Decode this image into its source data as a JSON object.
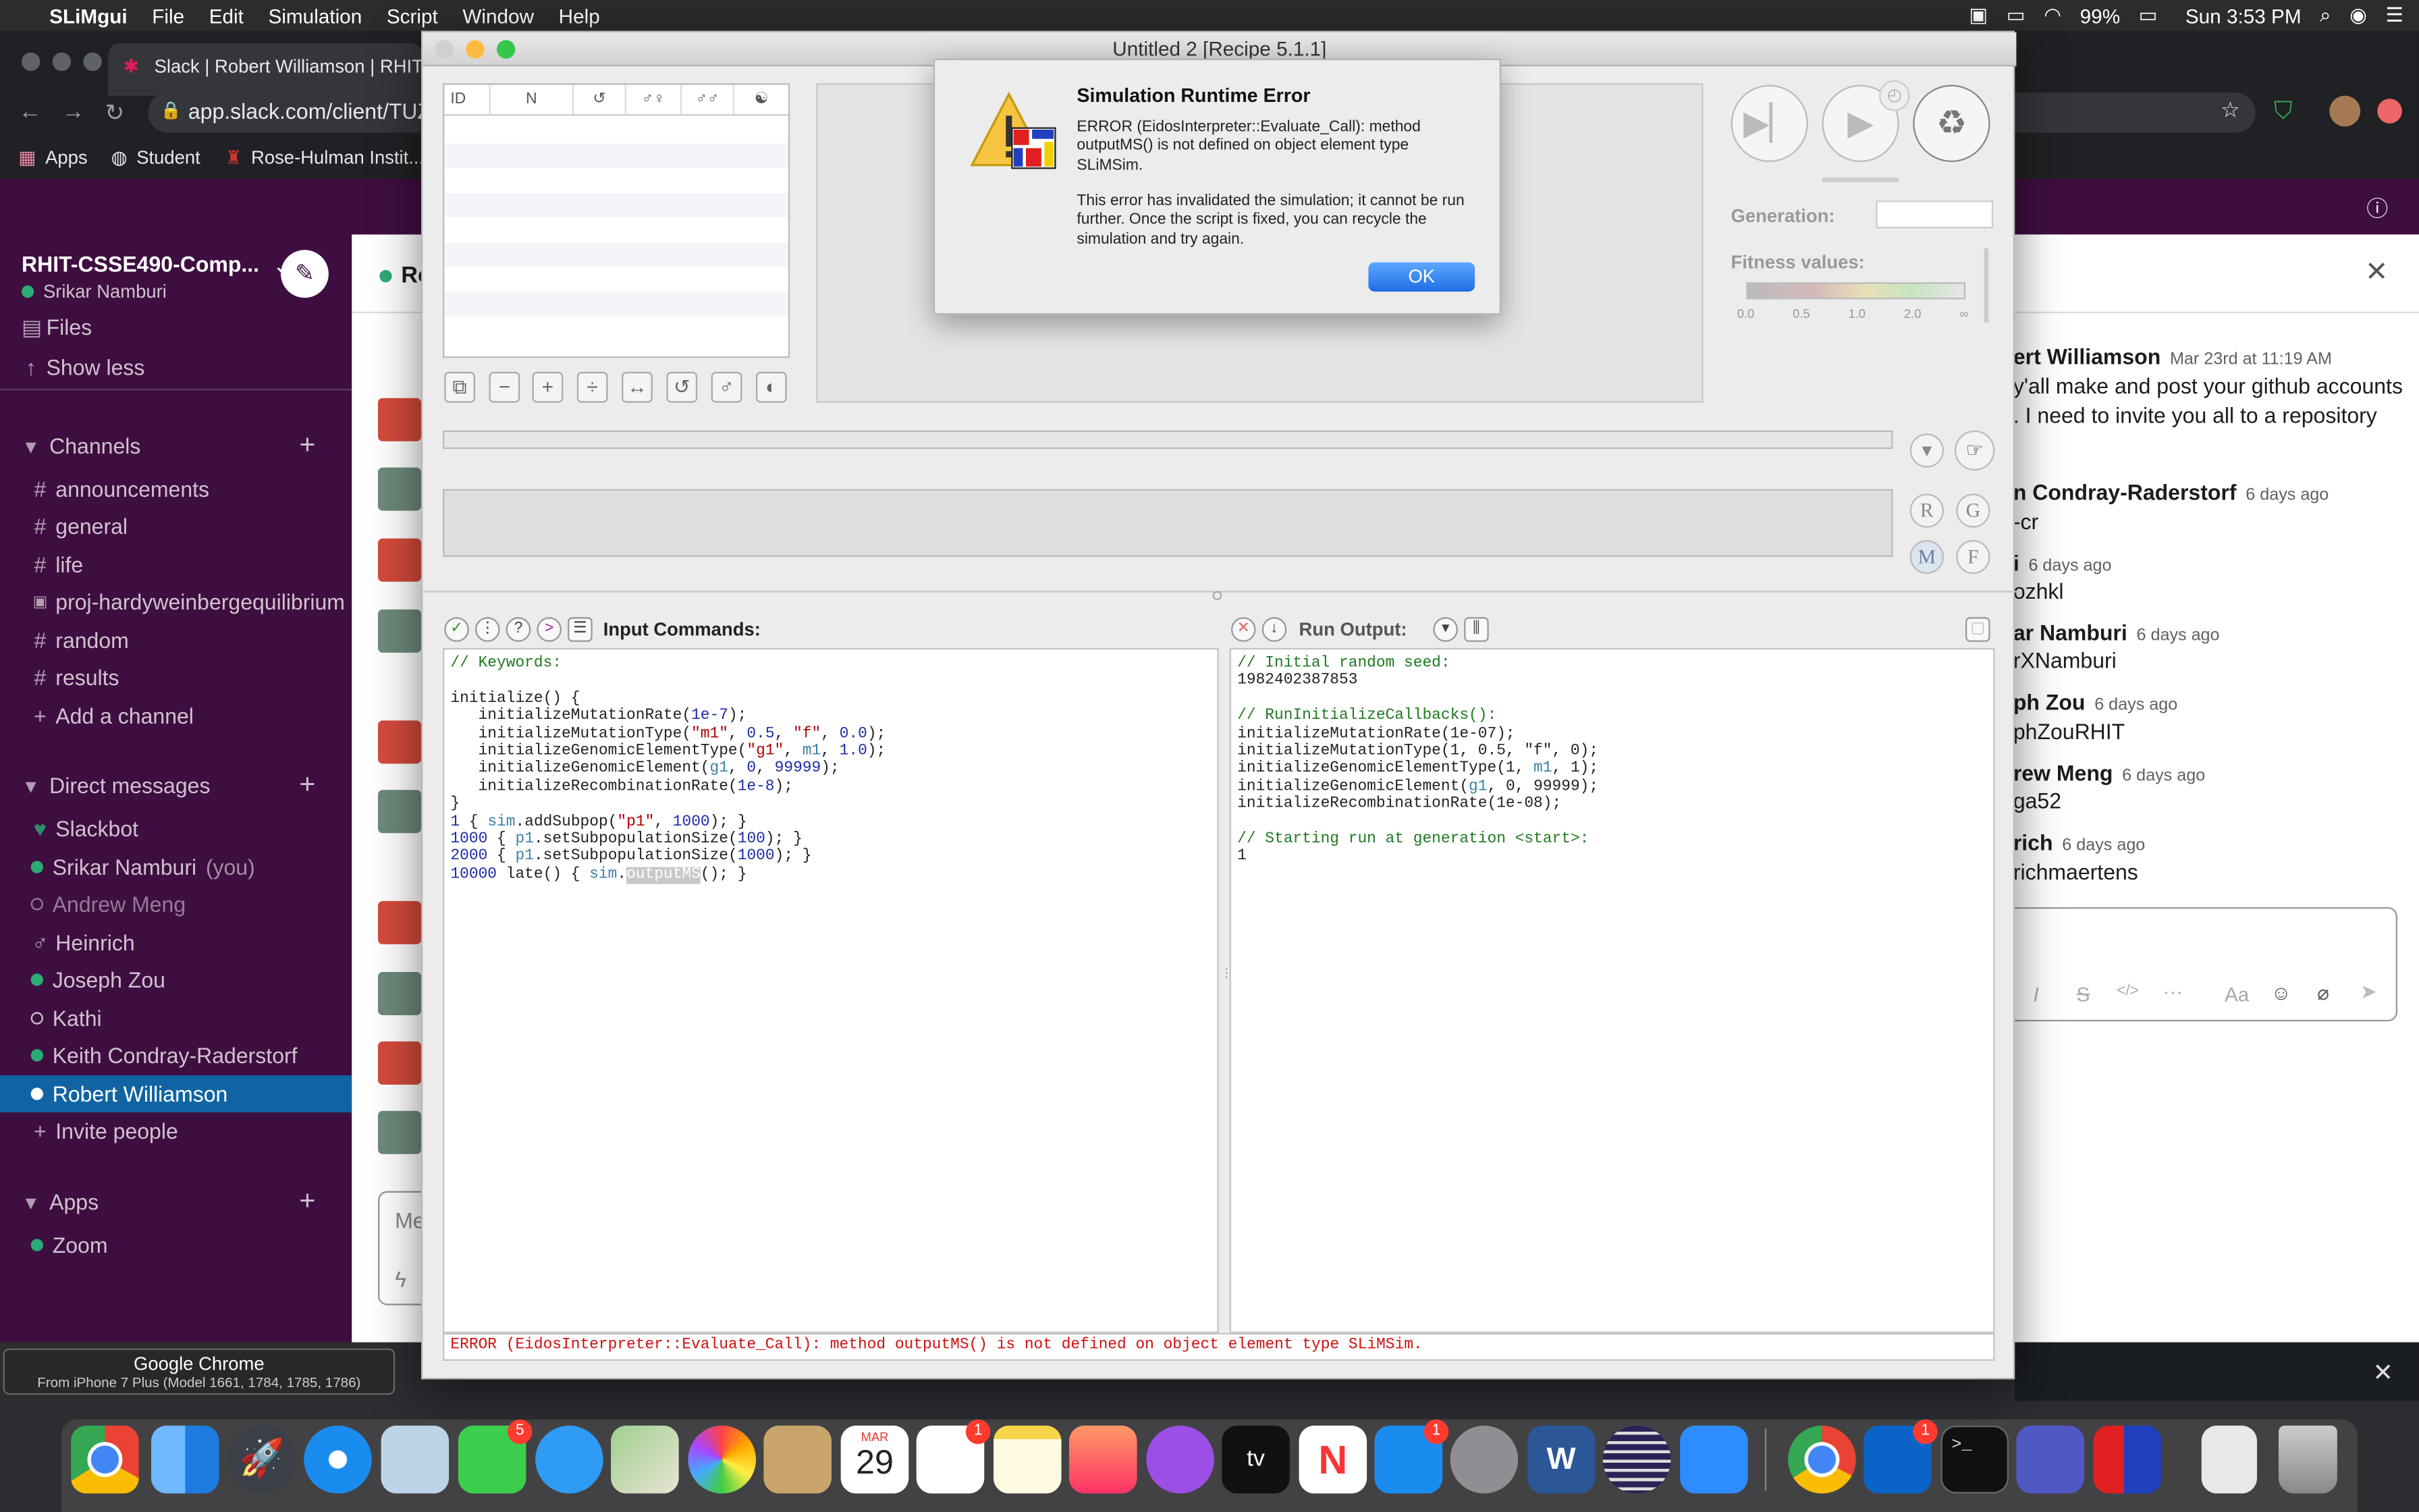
{
  "menubar": {
    "app_name": "SLiMgui",
    "items": [
      "File",
      "Edit",
      "Simulation",
      "Script",
      "Window",
      "Help"
    ],
    "battery": "99%",
    "clock": "Sun 3:53 PM"
  },
  "chrome": {
    "tab_title": "Slack | Robert Williamson | RHIT",
    "url": "app.slack.com/client/TUZF",
    "bookmarks": [
      "Apps",
      "Student",
      "Rose-Hulman Instit..."
    ]
  },
  "slack": {
    "workspace": "RHIT-CSSE490-Comp...",
    "user": "Srikar Namburi",
    "nav": [
      "Files",
      "Show less"
    ],
    "channels_header": "Channels",
    "channels": [
      {
        "glyph": "#",
        "name": "announcements"
      },
      {
        "glyph": "#",
        "name": "general"
      },
      {
        "glyph": "#",
        "name": "life"
      },
      {
        "glyph": "lock",
        "name": "proj-hardyweinbergequilibrium"
      },
      {
        "glyph": "#",
        "name": "random"
      },
      {
        "glyph": "#",
        "name": "results"
      }
    ],
    "add_channel": "Add a channel",
    "dm_header": "Direct messages",
    "dms": [
      {
        "name": "Slackbot",
        "status": "heart"
      },
      {
        "name": "Srikar Namburi",
        "suffix": "(you)",
        "status": "online"
      },
      {
        "name": "Andrew Meng",
        "status": "away"
      },
      {
        "name": "Heinrich",
        "status": "symbol"
      },
      {
        "name": "Joseph Zou",
        "status": "online"
      },
      {
        "name": "Kathi",
        "status": "away"
      },
      {
        "name": "Keith Condray-Raderstorf",
        "status": "online"
      },
      {
        "name": "Robert Williamson",
        "status": "online"
      }
    ],
    "invite": "Invite people",
    "apps_header": "Apps",
    "apps": [
      "Zoom"
    ],
    "channel_header_partial": "Ro",
    "composer_partial": "Me",
    "messages": [
      {
        "name": "ert Williamson",
        "time": "Mar 23rd at 11:19 AM",
        "lines": [
          "y'all make and post your github accounts",
          ". I need to invite you all to a repository"
        ]
      },
      {
        "name": "n Condray-Raderstorf",
        "time": "6 days ago",
        "lines": [
          "-cr"
        ]
      },
      {
        "name": "i",
        "time": "6 days ago",
        "lines": [
          "ozhkl"
        ]
      },
      {
        "name": "ar Namburi",
        "time": "6 days ago",
        "lines": [
          "rXNamburi"
        ]
      },
      {
        "name": "ph Zou",
        "time": "6 days ago",
        "lines": [
          "phZouRHIT"
        ]
      },
      {
        "name": "rew Meng",
        "time": "6 days ago",
        "lines": [
          "ga52"
        ]
      },
      {
        "name": "rich",
        "time": "6 days ago",
        "lines": [
          "richmaertens"
        ]
      }
    ],
    "composer_aa": "Aa"
  },
  "slim": {
    "window_title": "Untitled 2 [Recipe 5.1.1]",
    "table_headers": [
      "ID",
      "N",
      "↺",
      "♂♀",
      "♂♂",
      "☯"
    ],
    "generation_label": "Generation:",
    "fitness_label": "Fitness values:",
    "fitness_ticks": [
      "0.0",
      "0.5",
      "1.0",
      "2.0",
      "∞"
    ],
    "chromosome_buttons": [
      "R",
      "G",
      "M",
      "F"
    ],
    "input_label": "Input Commands:",
    "output_label": "Run Output:",
    "status_error": "ERROR (EidosInterpreter::Evaluate_Call): method outputMS() is not defined on object element type SLiMSim."
  },
  "dialog": {
    "title": "Simulation Runtime Error",
    "message1": "ERROR (EidosInterpreter::Evaluate_Call): method outputMS() is not defined on object element type SLiMSim.",
    "message2": "This error has invalidated the simulation; it cannot be run further.  Once the script is fixed, you can recycle the simulation and try again.",
    "ok_label": "OK"
  },
  "dock": {
    "tooltip_title": "Google Chrome",
    "tooltip_sub": "From iPhone 7 Plus (Model 1661, 1784, 1785, 1786)",
    "calendar_month": "MAR",
    "calendar_day": "29",
    "facetime_badge": "5",
    "reminders_badge": "1",
    "appstore_badge": "1",
    "outlook_badge": "1",
    "tv_label": "tv"
  },
  "colors": {
    "slack_purple": "#3f0e40",
    "slack_active": "#1164a3",
    "error_red": "#d01010",
    "ok_blue": "#1f6de6"
  }
}
